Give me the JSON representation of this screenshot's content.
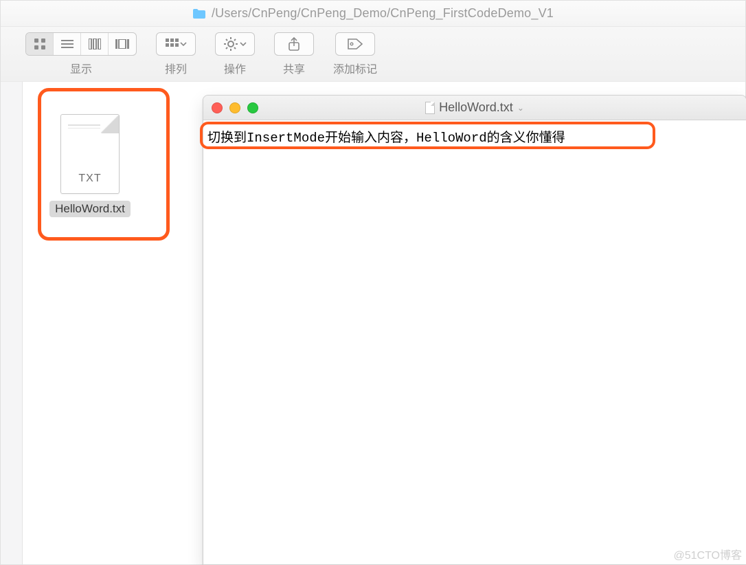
{
  "finder": {
    "path": "/Users/CnPeng/CnPeng_Demo/CnPeng_FirstCodeDemo_V1",
    "toolbar": {
      "view_label": "显示",
      "arrange_label": "排列",
      "action_label": "操作",
      "share_label": "共享",
      "tags_label": "添加标记"
    },
    "file": {
      "extension": "TXT",
      "name": "HelloWord.txt"
    }
  },
  "textedit": {
    "title": "HelloWord.txt",
    "content": "切换到InsertMode开始输入内容，HelloWord的含义你懂得"
  },
  "watermark": "@51CTO博客"
}
